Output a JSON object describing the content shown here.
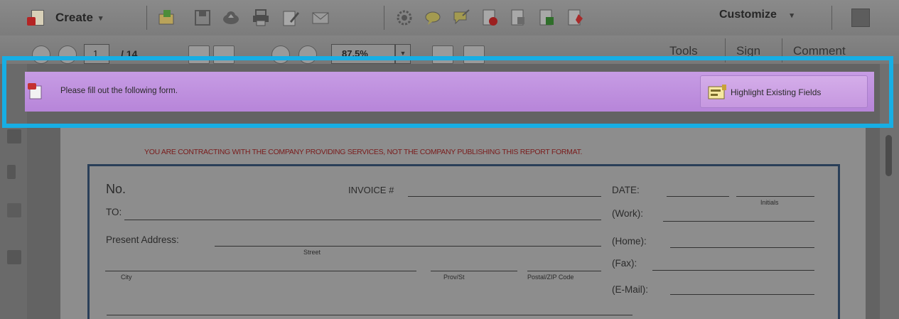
{
  "toolbar": {
    "create_label": "Create",
    "customize_label": "Customize",
    "icons": [
      "open-folder-icon",
      "save-icon",
      "cloud-upload-icon",
      "print-icon",
      "edit-icon",
      "email-icon",
      "settings-icon",
      "comment-icon",
      "sign-icon",
      "pdf-red-icon",
      "pdf-doc-icon",
      "pdf-green-icon",
      "pdf-star-icon"
    ]
  },
  "navbar": {
    "page_current": "1",
    "page_total": "/ 14",
    "zoom": "87.5%",
    "tabs": [
      "Tools",
      "Sign",
      "Comment"
    ]
  },
  "form_bar": {
    "message": "Please fill out the following form.",
    "highlight_button": "Highlight Existing Fields",
    "color": "#c296e2"
  },
  "document": {
    "warning": "YOU ARE CONTRACTING WITH THE COMPANY PROVIDING SERVICES, NOT THE COMPANY PUBLISHING THIS REPORT FORMAT.",
    "no_label": "No.",
    "invoice_label": "INVOICE #",
    "date_label": "DATE:",
    "initials_label": "Initials",
    "to_label": "TO:",
    "work_label": "(Work):",
    "present_address_label": "Present Address:",
    "home_label": "(Home):",
    "street_label": "Street",
    "fax_label": "(Fax):",
    "city_label": "City",
    "prov_label": "Prov/St",
    "postal_label": "Postal/ZIP Code",
    "email_label": "(E-Mail):"
  },
  "colors": {
    "callout_border": "#17aee4",
    "frame": "#2a3f58",
    "warning_text": "#7a1c1c"
  }
}
